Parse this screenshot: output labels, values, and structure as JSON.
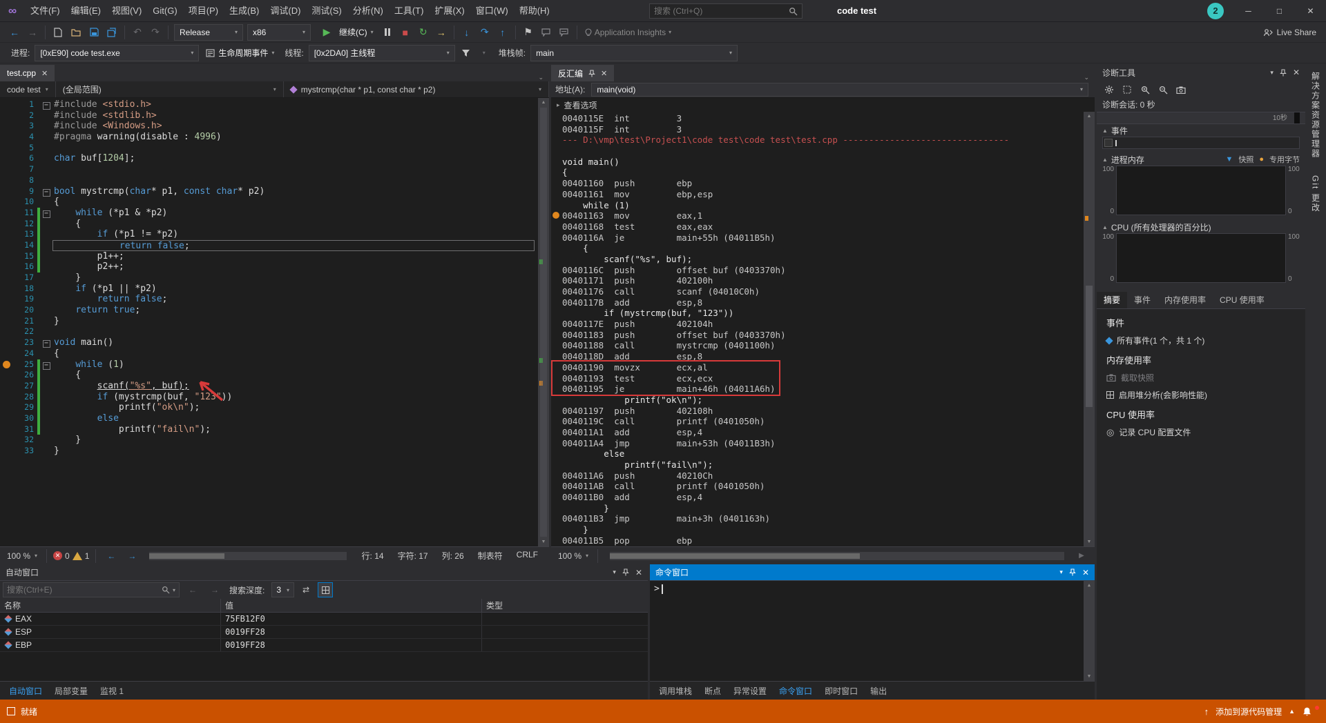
{
  "colors": {
    "accent": "#007acc",
    "status_bar": "#ca5100",
    "breakpoint_orange": "#e0871e",
    "annotation_red": "#d83a3a",
    "keyword_blue": "#569cd6",
    "string_brown": "#d69d85"
  },
  "icons": {
    "minimize": "─",
    "maximize": "□",
    "close": "✕",
    "chevron_down": "▾",
    "chevron_right": "▸",
    "back": "←",
    "forward": "→",
    "undo": "↶",
    "redo": "↷",
    "play": "▶",
    "stop": "■",
    "restart": "↻",
    "step_into": "↓",
    "step_over": "↷",
    "step_out": "↑",
    "bookmark": "⚑",
    "record": "◎",
    "logo": "∞"
  },
  "title_bar": {
    "menus": [
      "文件(F)",
      "编辑(E)",
      "视图(V)",
      "Git(G)",
      "项目(P)",
      "生成(B)",
      "调试(D)",
      "测试(S)",
      "分析(N)",
      "工具(T)",
      "扩展(X)",
      "窗口(W)",
      "帮助(H)"
    ],
    "search_placeholder": "搜索 (Ctrl+Q)",
    "window_title": "code test",
    "user_badge": "2"
  },
  "toolbar": {
    "config": "Release",
    "platform": "x86",
    "continue_label": "继续(C)",
    "app_insights": "Application Insights",
    "live_share": "Live Share"
  },
  "debug_bar": {
    "process_label": "进程:",
    "process_value": "[0xE90] code test.exe",
    "lifecycle_label": "生命周期事件",
    "thread_label": "线程:",
    "thread_value": "[0x2DA0] 主线程",
    "stack_label": "堆栈帧:",
    "stack_value": "main"
  },
  "editor": {
    "tab": "test.cpp",
    "breadcrumbs": [
      "code test",
      "(全局范围)",
      "mystrcmp(char * p1, const char * p2)"
    ],
    "zoom": "100 %",
    "errors": "0",
    "warnings": "1",
    "status": {
      "line": "行: 14",
      "char": "字符: 17",
      "col": "列: 26",
      "tabs": "制表符",
      "eol": "CRLF"
    },
    "lines": [
      {
        "n": 1,
        "f": 1,
        "s": [
          [
            "#include ",
            "p"
          ],
          [
            "<stdio.h>",
            "s"
          ]
        ]
      },
      {
        "n": 2,
        "s": [
          [
            "#include ",
            "p"
          ],
          [
            "<stdlib.h>",
            "s"
          ]
        ]
      },
      {
        "n": 3,
        "s": [
          [
            "#include ",
            "p"
          ],
          [
            "<Windows.h>",
            "s"
          ]
        ]
      },
      {
        "n": 4,
        "s": [
          [
            "#pragma ",
            "p"
          ],
          [
            "warning(disable : ",
            "t"
          ],
          [
            "4996",
            "n"
          ],
          [
            ")",
            "t"
          ]
        ]
      },
      {
        "n": 5,
        "s": []
      },
      {
        "n": 6,
        "s": [
          [
            "char",
            "k"
          ],
          [
            " buf[",
            "t"
          ],
          [
            "1204",
            "n"
          ],
          [
            "];",
            "t"
          ]
        ]
      },
      {
        "n": 7,
        "s": []
      },
      {
        "n": 8,
        "s": []
      },
      {
        "n": 9,
        "f": 1,
        "s": [
          [
            "bool",
            "k"
          ],
          [
            " mystrcmp(",
            "t"
          ],
          [
            "char",
            "k"
          ],
          [
            "* p1, ",
            "t"
          ],
          [
            "const",
            "k"
          ],
          [
            " ",
            "t"
          ],
          [
            "char",
            "k"
          ],
          [
            "* p2)",
            "t"
          ]
        ]
      },
      {
        "n": 10,
        "s": [
          [
            "{",
            "t"
          ]
        ]
      },
      {
        "n": 11,
        "f": 1,
        "g": 1,
        "s": [
          [
            "    ",
            "t"
          ],
          [
            "while",
            "k"
          ],
          [
            " (*p1 & *p2)",
            "t"
          ]
        ]
      },
      {
        "n": 12,
        "g": 1,
        "s": [
          [
            "    {",
            "t"
          ]
        ]
      },
      {
        "n": 13,
        "g": 1,
        "s": [
          [
            "        ",
            "t"
          ],
          [
            "if",
            "k"
          ],
          [
            " (*p1 != *p2)",
            "t"
          ]
        ]
      },
      {
        "n": 14,
        "g": 1,
        "c": 1,
        "s": [
          [
            "            ",
            "t"
          ],
          [
            "return",
            "k"
          ],
          [
            " ",
            "t"
          ],
          [
            "false",
            "k"
          ],
          [
            ";",
            "t"
          ]
        ]
      },
      {
        "n": 15,
        "g": 1,
        "s": [
          [
            "        p1++;",
            "t"
          ]
        ]
      },
      {
        "n": 16,
        "g": 1,
        "s": [
          [
            "        p2++;",
            "t"
          ]
        ]
      },
      {
        "n": 17,
        "s": [
          [
            "    }",
            "t"
          ]
        ]
      },
      {
        "n": 18,
        "s": [
          [
            "    ",
            "t"
          ],
          [
            "if",
            "k"
          ],
          [
            " (*p1 || *p2)",
            "t"
          ]
        ]
      },
      {
        "n": 19,
        "s": [
          [
            "        ",
            "t"
          ],
          [
            "return",
            "k"
          ],
          [
            " ",
            "t"
          ],
          [
            "false",
            "k"
          ],
          [
            ";",
            "t"
          ]
        ]
      },
      {
        "n": 20,
        "s": [
          [
            "    ",
            "t"
          ],
          [
            "return",
            "k"
          ],
          [
            " ",
            "t"
          ],
          [
            "true",
            "k"
          ],
          [
            ";",
            "t"
          ]
        ]
      },
      {
        "n": 21,
        "s": [
          [
            "}",
            "t"
          ]
        ]
      },
      {
        "n": 22,
        "s": []
      },
      {
        "n": 23,
        "f": 1,
        "s": [
          [
            "void",
            "k"
          ],
          [
            " main()",
            "t"
          ]
        ]
      },
      {
        "n": 24,
        "s": [
          [
            "{",
            "t"
          ]
        ]
      },
      {
        "n": 25,
        "f": 1,
        "b": 1,
        "g": 1,
        "s": [
          [
            "    ",
            "t"
          ],
          [
            "while",
            "k"
          ],
          [
            " (",
            "t"
          ],
          [
            "1",
            "n"
          ],
          [
            ")",
            "t"
          ]
        ]
      },
      {
        "n": 26,
        "g": 1,
        "s": [
          [
            "    {",
            "t"
          ]
        ]
      },
      {
        "n": 27,
        "g": 1,
        "s": [
          [
            "        ",
            "t"
          ],
          [
            "scanf(",
            "tu"
          ],
          [
            "\"%s\"",
            "su"
          ],
          [
            ", buf);",
            "tu"
          ]
        ]
      },
      {
        "n": 28,
        "g": 1,
        "s": [
          [
            "        ",
            "t"
          ],
          [
            "if",
            "k"
          ],
          [
            " (mystrcmp(buf, ",
            "t"
          ],
          [
            "\"123\"",
            "s"
          ],
          [
            "))",
            "t"
          ]
        ]
      },
      {
        "n": 29,
        "g": 1,
        "s": [
          [
            "            printf(",
            "t"
          ],
          [
            "\"ok\\n\"",
            "s"
          ],
          [
            ");",
            "t"
          ]
        ]
      },
      {
        "n": 30,
        "g": 1,
        "s": [
          [
            "        ",
            "t"
          ],
          [
            "else",
            "k"
          ]
        ]
      },
      {
        "n": 31,
        "g": 1,
        "s": [
          [
            "            printf(",
            "t"
          ],
          [
            "\"fail\\n\"",
            "s"
          ],
          [
            ");",
            "t"
          ]
        ]
      },
      {
        "n": 32,
        "s": [
          [
            "    }",
            "t"
          ]
        ]
      },
      {
        "n": 33,
        "s": [
          [
            "}",
            "t"
          ]
        ]
      }
    ]
  },
  "disasm": {
    "tab": "反汇编",
    "address_label": "地址(A):",
    "address_value": "main(void)",
    "view_options": "查看选项",
    "zoom": "100 %",
    "lines": [
      {
        "t": "asm",
        "a": "0040115E",
        "x": "int         3"
      },
      {
        "t": "asm",
        "a": "0040115F",
        "x": "int         3"
      },
      {
        "t": "path",
        "x": "--- D:\\vmp\\test\\Project1\\code test\\code test\\test.cpp --------------------------------"
      },
      {
        "t": "blank",
        "x": ""
      },
      {
        "t": "src",
        "x": "void main()"
      },
      {
        "t": "src",
        "x": "{"
      },
      {
        "t": "asm",
        "a": "00401160",
        "x": "push        ebp"
      },
      {
        "t": "asm",
        "a": "00401161",
        "x": "mov         ebp,esp"
      },
      {
        "t": "src",
        "x": "    while (1)"
      },
      {
        "t": "asm",
        "a": "00401163",
        "x": "mov         eax,1",
        "b": 1
      },
      {
        "t": "asm",
        "a": "00401168",
        "x": "test        eax,eax"
      },
      {
        "t": "asm",
        "a": "0040116A",
        "x": "je          main+55h (04011B5h)"
      },
      {
        "t": "src",
        "x": "    {"
      },
      {
        "t": "src",
        "x": "        scanf(\"%s\", buf);"
      },
      {
        "t": "asm",
        "a": "0040116C",
        "x": "push        offset buf (0403370h)"
      },
      {
        "t": "asm",
        "a": "00401171",
        "x": "push        402100h"
      },
      {
        "t": "asm",
        "a": "00401176",
        "x": "call        scanf (04010C0h)"
      },
      {
        "t": "asm",
        "a": "0040117B",
        "x": "add         esp,8"
      },
      {
        "t": "src",
        "x": "        if (mystrcmp(buf, \"123\"))"
      },
      {
        "t": "asm",
        "a": "0040117E",
        "x": "push        402104h"
      },
      {
        "t": "asm",
        "a": "00401183",
        "x": "push        offset buf (0403370h)"
      },
      {
        "t": "asm",
        "a": "00401188",
        "x": "call        mystrcmp (0401100h)"
      },
      {
        "t": "asm",
        "a": "0040118D",
        "x": "add         esp,8"
      },
      {
        "t": "asm",
        "a": "00401190",
        "x": "movzx       ecx,al"
      },
      {
        "t": "asm",
        "a": "00401193",
        "x": "test        ecx,ecx"
      },
      {
        "t": "asm",
        "a": "00401195",
        "x": "je          main+46h (04011A6h)"
      },
      {
        "t": "src",
        "x": "            printf(\"ok\\n\");"
      },
      {
        "t": "asm",
        "a": "00401197",
        "x": "push        402108h"
      },
      {
        "t": "asm",
        "a": "0040119C",
        "x": "call        printf (0401050h)"
      },
      {
        "t": "asm",
        "a": "004011A1",
        "x": "add         esp,4"
      },
      {
        "t": "asm",
        "a": "004011A4",
        "x": "jmp         main+53h (04011B3h)"
      },
      {
        "t": "src",
        "x": "        else"
      },
      {
        "t": "src",
        "x": "            printf(\"fail\\n\");"
      },
      {
        "t": "asm",
        "a": "004011A6",
        "x": "push        40210Ch"
      },
      {
        "t": "asm",
        "a": "004011AB",
        "x": "call        printf (0401050h)"
      },
      {
        "t": "asm",
        "a": "004011B0",
        "x": "add         esp,4"
      },
      {
        "t": "src",
        "x": "        }"
      },
      {
        "t": "asm",
        "a": "004011B3",
        "x": "jmp         main+3h (0401163h)"
      },
      {
        "t": "src",
        "x": "    }"
      },
      {
        "t": "asm",
        "a": "004011B5",
        "x": "pop         ebp"
      }
    ]
  },
  "diagnostics": {
    "title": "诊断工具",
    "session": "诊断会话: 0 秒",
    "time_label": "10秒",
    "events_header": "事件",
    "memory_header": "进程内存",
    "legend_snapshot": "快照",
    "legend_private_bytes": "专用字节",
    "cpu_header": "CPU (所有处理器的百分比)",
    "axis_top": "100",
    "axis_bottom": "0",
    "tabs": [
      {
        "label": "摘要",
        "active": true
      },
      {
        "label": "事件",
        "active": false
      },
      {
        "label": "内存使用率",
        "active": false
      },
      {
        "label": "CPU 使用率",
        "active": false
      }
    ],
    "summary": {
      "events_title": "事件",
      "all_events": "所有事件(1 个，共 1 个)",
      "memory_title": "内存使用率",
      "snapshot_action": "截取快照",
      "heap_action": "启用堆分析(会影响性能)",
      "cpu_title": "CPU 使用率",
      "record_action": "记录 CPU 配置文件"
    }
  },
  "autos": {
    "title": "自动窗口",
    "search_placeholder": "搜索(Ctrl+E)",
    "depth_label": "搜索深度:",
    "depth_value": "3",
    "columns": {
      "name": "名称",
      "value": "值",
      "type": "类型"
    },
    "rows": [
      {
        "name": "EAX",
        "value": "75FB12F0",
        "type": ""
      },
      {
        "name": "ESP",
        "value": "0019FF28",
        "type": ""
      },
      {
        "name": "EBP",
        "value": "0019FF28",
        "type": ""
      }
    ]
  },
  "command_window": {
    "title": "命令窗口",
    "prompt": ">"
  },
  "panel_tabs_left": [
    {
      "label": "自动窗口",
      "active": true
    },
    {
      "label": "局部变量",
      "active": false
    },
    {
      "label": "监视 1",
      "active": false
    }
  ],
  "panel_tabs_right": [
    {
      "label": "调用堆栈",
      "active": false
    },
    {
      "label": "断点",
      "active": false
    },
    {
      "label": "异常设置",
      "active": false
    },
    {
      "label": "命令窗口",
      "active": true
    },
    {
      "label": "即时窗口",
      "active": false
    },
    {
      "label": "输出",
      "active": false
    }
  ],
  "right_strip": [
    "解决方案资源管理器",
    "Git 更改"
  ],
  "status_bar": {
    "ready": "就绪",
    "add_to_source_control": "添加到源代码管理"
  }
}
